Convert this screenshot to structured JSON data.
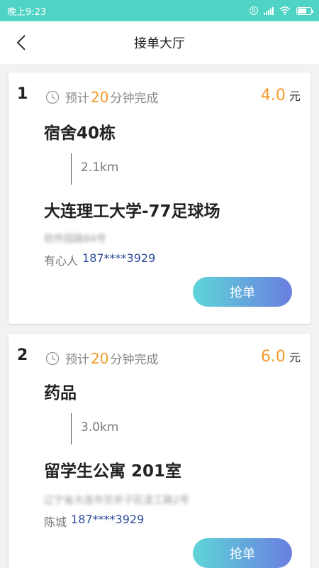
{
  "status_bar": {
    "time": "晚上9:23",
    "r_badge": "R"
  },
  "nav": {
    "title": "接单大厅",
    "back_icon": "chevron-left-icon"
  },
  "orders": [
    {
      "index": "1",
      "eta_prefix": "预计",
      "eta_minutes": "20",
      "eta_suffix": "分钟完成",
      "price": "4.0",
      "price_unit": "元",
      "from": "宿舍40栋",
      "distance": "2.1km",
      "to": "大连理工大学-77足球场",
      "address_blurred": "软件园路84号",
      "contact_name": "有心人",
      "contact_phone": "187****3929",
      "action_label": "抢单"
    },
    {
      "index": "2",
      "eta_prefix": "预计",
      "eta_minutes": "20",
      "eta_suffix": "分钟完成",
      "price": "6.0",
      "price_unit": "元",
      "from": "药品",
      "distance": "3.0km",
      "to": "留学生公寓 201室",
      "address_blurred": "辽宁省大连市甘井子区凌工路2号",
      "contact_name": "陈城",
      "contact_phone": "187****3929",
      "action_label": "抢单"
    }
  ],
  "colors": {
    "status_bar": "#4fd3c4",
    "accent_orange": "#f39a2b",
    "phone_blue": "#2b4c9b",
    "button_gradient_start": "#5ed6d8",
    "button_gradient_end": "#6a7ee0"
  }
}
